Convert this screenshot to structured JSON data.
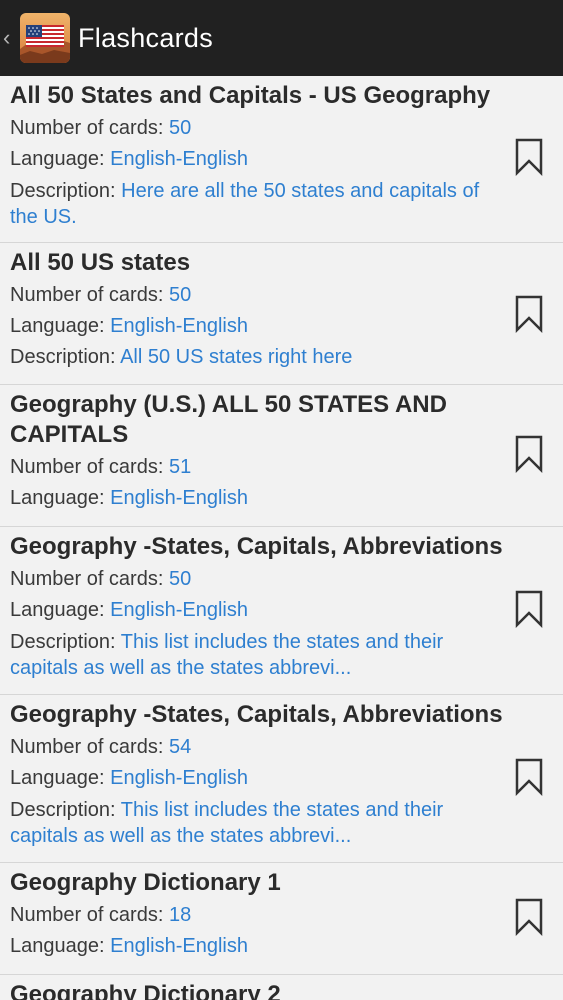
{
  "actionbar": {
    "title": "Flashcards",
    "app_icon": "us-flag-canyon-icon",
    "up_icon": "chevron-left-icon"
  },
  "labels": {
    "cards": "Number of cards: ",
    "language": "Language: ",
    "description": "Description: "
  },
  "items": [
    {
      "title": "All 50 States and Capitals - US Geography",
      "cards": "50",
      "language": "English-English",
      "description": "Here are all the 50 states and capitals of the US."
    },
    {
      "title": "All 50 US states",
      "cards": "50",
      "language": "English-English",
      "description": "All 50 US states right here"
    },
    {
      "title": "Geography (U.S.) ALL 50 STATES AND CAPITALS",
      "cards": "51",
      "language": "English-English",
      "description": ""
    },
    {
      "title": "Geography -States, Capitals, Abbreviations",
      "cards": "50",
      "language": "English-English",
      "description": "This list includes the states and their capitals as well as the states abbrevi..."
    },
    {
      "title": "Geography -States, Capitals, Abbreviations",
      "cards": "54",
      "language": "English-English",
      "description": "This list includes the states and their capitals as well as the states abbrevi..."
    },
    {
      "title": "Geography Dictionary 1",
      "cards": "18",
      "language": "English-English",
      "description": ""
    },
    {
      "title": "Geography Dictionary 2",
      "cards": "",
      "language": "",
      "description": ""
    }
  ],
  "colors": {
    "actionbar_bg": "#212121",
    "list_bg": "#f2f2f2",
    "value_blue": "#2e7fd0",
    "title_text": "#2b2b2b"
  }
}
